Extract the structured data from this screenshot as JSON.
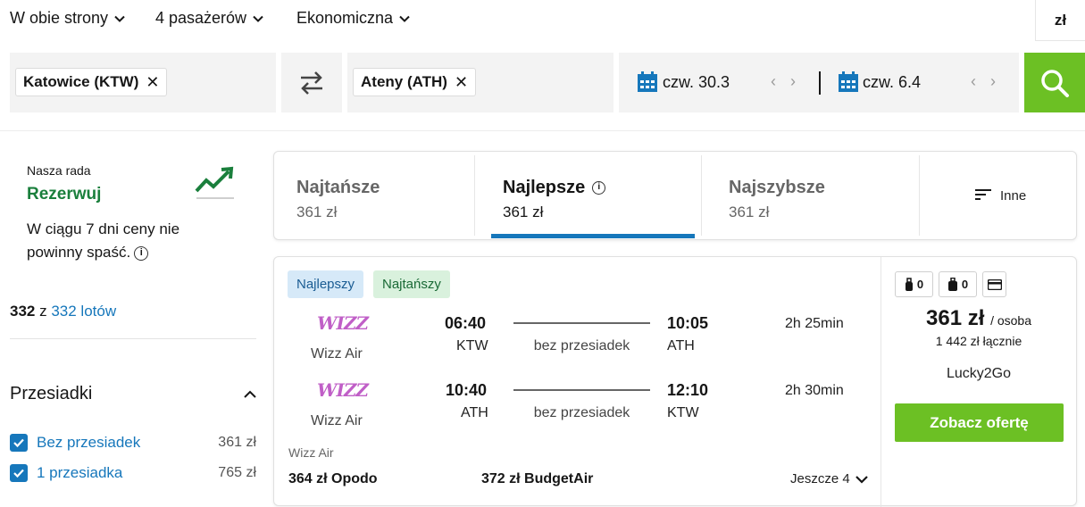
{
  "top_options": {
    "trip_type": "W obie strony",
    "passengers": "4 pasażerów",
    "cabin": "Ekonomiczna",
    "currency": "zł"
  },
  "search": {
    "origin": "Katowice (KTW)",
    "destination": "Ateny (ATH)",
    "depart_date": "czw. 30.3",
    "return_date": "czw. 6.4"
  },
  "advice": {
    "title": "Nasza rada",
    "action": "Rezerwuj",
    "description": "W ciągu 7 dni ceny nie powinny spaść."
  },
  "results_count": {
    "shown": "332",
    "sep": " z ",
    "total_link": "332 lotów"
  },
  "filters": {
    "title": "Przesiadki",
    "items": [
      {
        "label": "Bez przesiadek",
        "price": "361 zł",
        "checked": true
      },
      {
        "label": "1 przesiadka",
        "price": "765 zł",
        "checked": true
      }
    ]
  },
  "sort_tabs": [
    {
      "title": "Najtańsze",
      "price": "361 zł"
    },
    {
      "title": "Najlepsze",
      "price": "361 zł",
      "active": true
    },
    {
      "title": "Najszybsze",
      "price": "361 zł"
    },
    {
      "title": "Inne"
    }
  ],
  "result": {
    "badges": [
      "Najlepszy",
      "Najtańszy"
    ],
    "legs": [
      {
        "logo": "WIZZ",
        "airline": "Wizz Air",
        "dep_time": "06:40",
        "dep_code": "KTW",
        "stops": "bez przesiadek",
        "arr_time": "10:05",
        "arr_code": "ATH",
        "duration": "2h 25min"
      },
      {
        "logo": "WIZZ",
        "airline": "Wizz Air",
        "dep_time": "10:40",
        "dep_code": "ATH",
        "stops": "bez przesiadek",
        "arr_time": "12:10",
        "arr_code": "KTW",
        "duration": "2h 30min"
      }
    ],
    "operator": "Wizz Air",
    "other_offers": [
      "364 zł Opodo",
      "372 zł BudgetAir"
    ],
    "more_label": "Jeszcze 4",
    "bags": {
      "personal": "0",
      "carry_on": "0"
    },
    "price": "361 zł",
    "per_person": "/ osoba",
    "total": "1 442 zł łącznie",
    "agency": "Lucky2Go",
    "cta": "Zobacz ofertę"
  },
  "colors": {
    "green": "#6cc024",
    "blue": "#1677bb",
    "advice_green": "#1a7f3c"
  }
}
